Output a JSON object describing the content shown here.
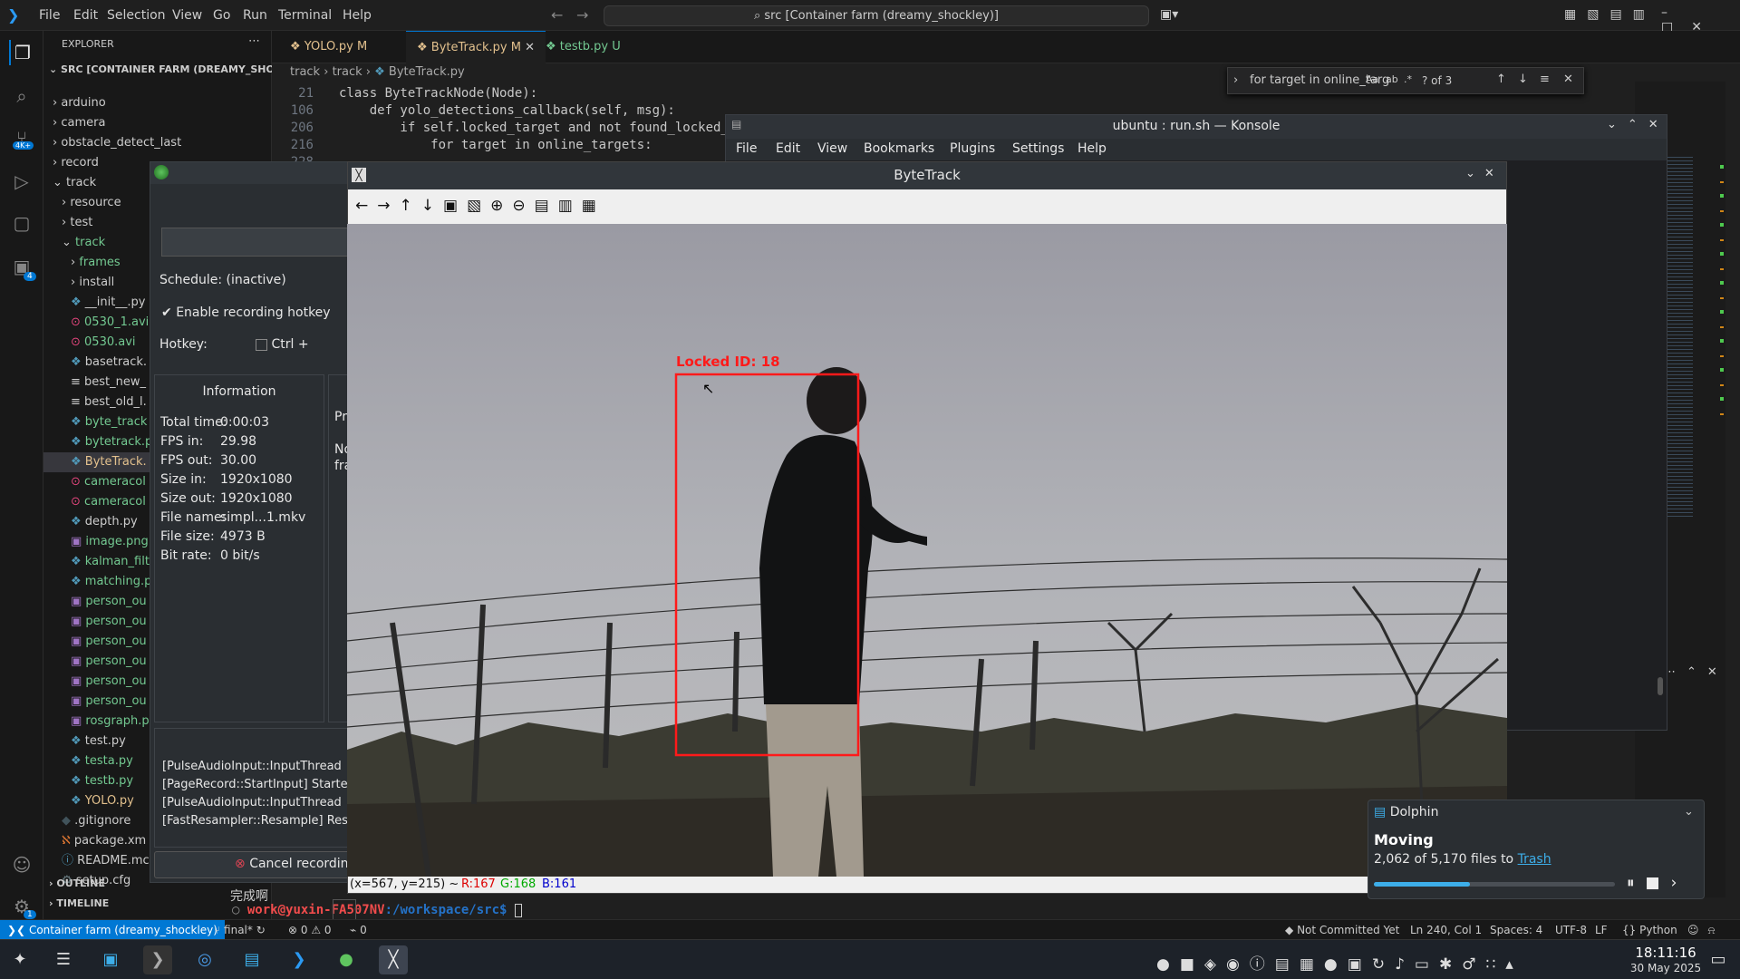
{
  "vscode": {
    "menu": [
      "File",
      "Edit",
      "Selection",
      "View",
      "Go",
      "Run",
      "Terminal",
      "Help"
    ],
    "command_center": "src [Container farm (dreamy_shockley)]",
    "explorer_title": "EXPLORER",
    "root": "SRC [CONTAINER FARM (DREAMY_SHOCK...",
    "tree": [
      "arduino",
      "camera",
      "obstacle_detect_last",
      "record",
      "track",
      "resource",
      "test",
      "track",
      "frames",
      "install",
      "__init__.py",
      "0530_1.avi",
      "0530.avi",
      "basetrack.",
      "best_new_",
      "best_old_l.",
      "byte_track",
      "bytetrack.p",
      "ByteTrack.",
      "cameracol",
      "cameracol",
      "depth.py",
      "image.png",
      "kalman_filt",
      "matching.p",
      "person_ou",
      "person_ou",
      "person_ou",
      "person_ou",
      "person_ou",
      "person_ou",
      "rosgraph.p",
      "test.py",
      "testa.py",
      "testb.py",
      "YOLO.py",
      ".gitignore",
      "package.xm",
      "README.mc",
      "setup.cfg"
    ],
    "outline": "OUTLINE",
    "timeline": "TIMELINE",
    "tabs": [
      {
        "label": "YOLO.py",
        "badge": "M"
      },
      {
        "label": "ByteTrack.py",
        "badge": "M"
      },
      {
        "label": "testb.py",
        "badge": "U"
      }
    ],
    "breadcrumb": [
      "track",
      "track",
      "ByteTrack.py"
    ],
    "find_text": "for target in online_targ",
    "find_count": "? of 3",
    "code": [
      {
        "n": "21",
        "t": "class ByteTrackNode(Node):"
      },
      {
        "n": "106",
        "t": "    def yolo_detections_callback(self, msg):"
      },
      {
        "n": "206",
        "t": "        if self.locked_target and not found_locked_"
      },
      {
        "n": "216",
        "t": "            for target in online_targets:"
      },
      {
        "n": "228",
        "t": ""
      }
    ],
    "terminal_prompt_user": "work@yuxin-FA507NV",
    "terminal_prompt_path": ":/workspace/src$",
    "terminal_cjk": "完成啊",
    "status": {
      "remote": "Container farm (dreamy_shockley)",
      "branch": "final*",
      "problems": "⊗ 0 ⚠ 0",
      "ports": "0",
      "commit": "Not Committed Yet",
      "pos": "Ln 240, Col 1",
      "spaces": "Spaces: 4",
      "enc": "UTF-8",
      "eol": "LF",
      "lang": "Python"
    },
    "badges": {
      "remote": "4K+",
      "ext": "4",
      "settings": "1"
    }
  },
  "konsole": {
    "title": "ubuntu : run.sh — Konsole",
    "menu": [
      "File",
      "Edit",
      "View",
      "Bookmarks",
      "Plugins",
      "Settings",
      "Help"
    ]
  },
  "recorder": {
    "schedule": "Schedule: (inactive)",
    "hotkey_enable": "Enable recording hotkey",
    "hotkey_label": "Hotkey:",
    "hotkey_mod": "Ctrl +",
    "info_title": "Information",
    "info": [
      [
        "Total time:",
        "0:00:03"
      ],
      [
        "FPS in:",
        "29.98"
      ],
      [
        "FPS out:",
        "30.00"
      ],
      [
        "Size in:",
        "1920x1080"
      ],
      [
        "Size out:",
        "1920x1080"
      ],
      [
        "File name:",
        "simpl...1.mkv"
      ],
      [
        "File size:",
        "4973 B"
      ],
      [
        "Bit rate:",
        "0 bit/s"
      ]
    ],
    "side_text": [
      "Pr",
      "No",
      "fra"
    ],
    "log": [
      "[PulseAudioInput::InputThread",
      "[PageRecord::StartInput] Starte",
      "[PulseAudioInput::InputThread",
      "[FastResampler::Resample] Res"
    ],
    "cancel": "Cancel recording"
  },
  "bytetrack": {
    "title": "ByteTrack",
    "label": "Locked ID: 18",
    "coords": "(x=567, y=215) ~",
    "r": "R:167",
    "g": "G:168",
    "b": "B:161"
  },
  "dolphin": {
    "app": "Dolphin",
    "heading": "Moving",
    "text": "2,062 of 5,170 files to",
    "link": "Trash",
    "progress": 0.4
  },
  "taskbar": {
    "time": "18:11:16",
    "date": "30 May 2025"
  }
}
